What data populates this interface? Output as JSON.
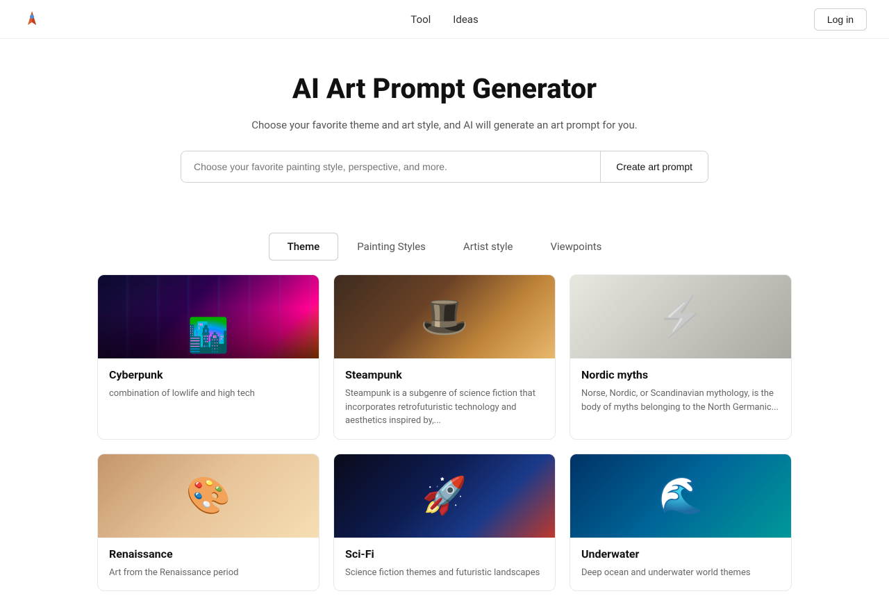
{
  "navbar": {
    "logo_alt": "AI Art Prompt Logo",
    "links": [
      {
        "label": "Tool",
        "href": "#"
      },
      {
        "label": "Ideas",
        "href": "#"
      }
    ],
    "login_label": "Log in"
  },
  "hero": {
    "title": "AI Art Prompt Generator",
    "subtitle": "Choose your favorite theme and art style, and AI will generate an art prompt for you.",
    "search_placeholder": "Choose your favorite painting style, perspective, and more.",
    "create_btn_label": "Create art prompt"
  },
  "tabs": [
    {
      "label": "Theme",
      "active": true
    },
    {
      "label": "Painting Styles",
      "active": false
    },
    {
      "label": "Artist style",
      "active": false
    },
    {
      "label": "Viewpoints",
      "active": false
    }
  ],
  "cards": [
    {
      "id": "cyberpunk",
      "title": "Cyberpunk",
      "desc": "combination of lowlife and high tech",
      "image_type": "cyberpunk"
    },
    {
      "id": "steampunk",
      "title": "Steampunk",
      "desc": "Steampunk is a subgenre of science fiction that incorporates retrofuturistic technology and aesthetics inspired by,...",
      "image_type": "steampunk"
    },
    {
      "id": "nordic-myths",
      "title": "Nordic myths",
      "desc": "Norse, Nordic, or Scandinavian mythology, is the body of myths belonging to the North Germanic...",
      "image_type": "nordic"
    },
    {
      "id": "renaissance",
      "title": "Renaissance",
      "desc": "Art from the Renaissance period",
      "image_type": "renaissance"
    },
    {
      "id": "sci-fi",
      "title": "Sci-Fi",
      "desc": "Science fiction themes and futuristic landscapes",
      "image_type": "scifi"
    },
    {
      "id": "underwater",
      "title": "Underwater",
      "desc": "Deep ocean and underwater world themes",
      "image_type": "underwater"
    }
  ]
}
